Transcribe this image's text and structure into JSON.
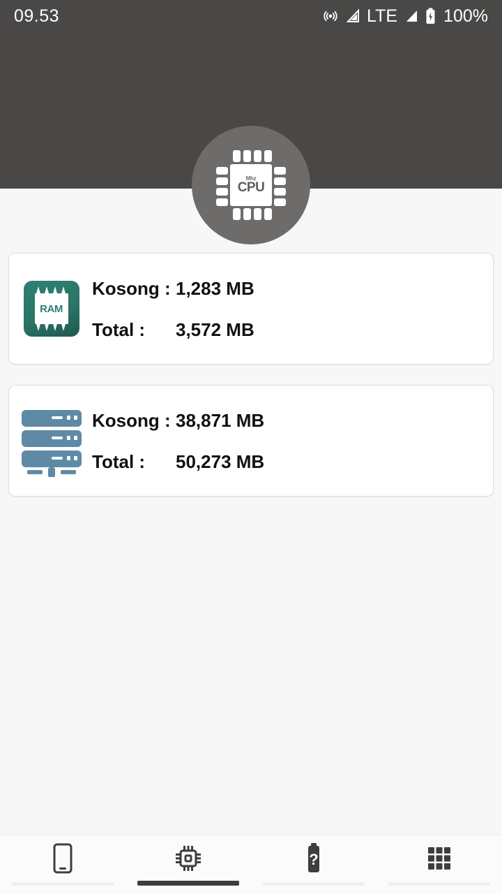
{
  "status_bar": {
    "time": "09.53",
    "battery_percent": "100%",
    "network_label": "LTE",
    "icons": [
      "hotspot-icon",
      "signal-icon-1",
      "signal-icon-2",
      "battery-charging-icon"
    ]
  },
  "header": {
    "icon_name": "cpu-icon",
    "cpu_chip_sub_label": "Mhz",
    "cpu_chip_label": "CPU",
    "background_color": "#4a4846",
    "badge_color": "#6e6c6b"
  },
  "cards": [
    {
      "id": "ram",
      "icon_name": "ram-chip-icon",
      "icon_label": "RAM",
      "icon_color": "#2e8073",
      "free_label": "Kosong :",
      "free_value": "1,283 MB",
      "total_label": "Total :",
      "total_value": "3,572 MB"
    },
    {
      "id": "storage",
      "icon_name": "server-storage-icon",
      "icon_label": "",
      "icon_color": "#5e8aa6",
      "free_label": "Kosong :",
      "free_value": "38,871 MB",
      "total_label": "Total :",
      "total_value": "50,273 MB"
    }
  ],
  "bottom_nav": {
    "active_index": 1,
    "items": [
      {
        "icon_name": "phone-icon",
        "label": ""
      },
      {
        "icon_name": "cpu-chip-icon",
        "label": ""
      },
      {
        "icon_name": "battery-question-icon",
        "label": ""
      },
      {
        "icon_name": "apps-grid-icon",
        "label": ""
      }
    ]
  }
}
